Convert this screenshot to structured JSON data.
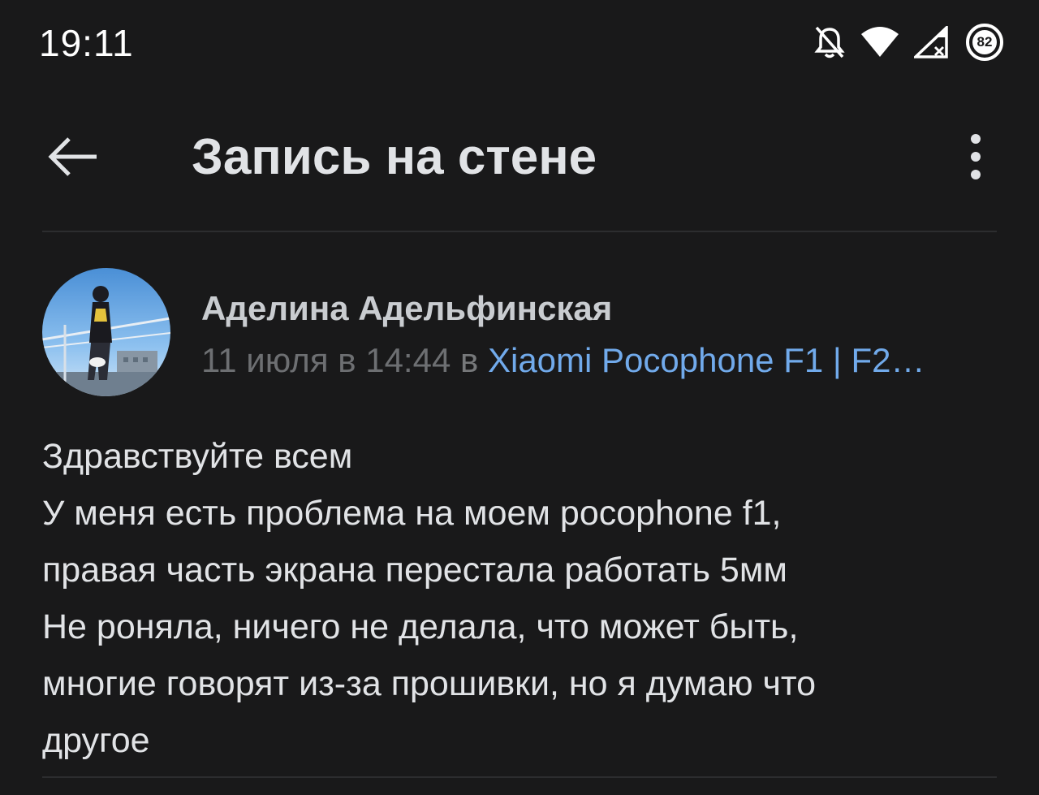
{
  "status_bar": {
    "time": "19:11",
    "battery_level": "82",
    "icons": [
      "notifications-off-icon",
      "wifi-icon",
      "cellular-no-data-icon",
      "battery-icon"
    ]
  },
  "toolbar": {
    "title": "Запись на стене",
    "back_icon": "arrow-left-icon",
    "more_icon": "more-vertical-icon"
  },
  "post": {
    "author": "Аделина Адельфинская",
    "date": "11 июля в 14:44",
    "in_word": " в ",
    "community": "Xiaomi Pocophone F1 | F2…",
    "lines": [
      "Здравствуйте всем",
      "У меня есть проблема на моем pocophone f1,",
      "правая часть экрана перестала работать 5мм",
      "Не роняла, ничего не делала, что может быть,",
      "многие говорят из-за прошивки, но я думаю что",
      "другое"
    ]
  },
  "colors": {
    "background": "#19191a",
    "text": "#e1e3e6",
    "secondary": "#76787a",
    "link": "#71aaeb"
  }
}
